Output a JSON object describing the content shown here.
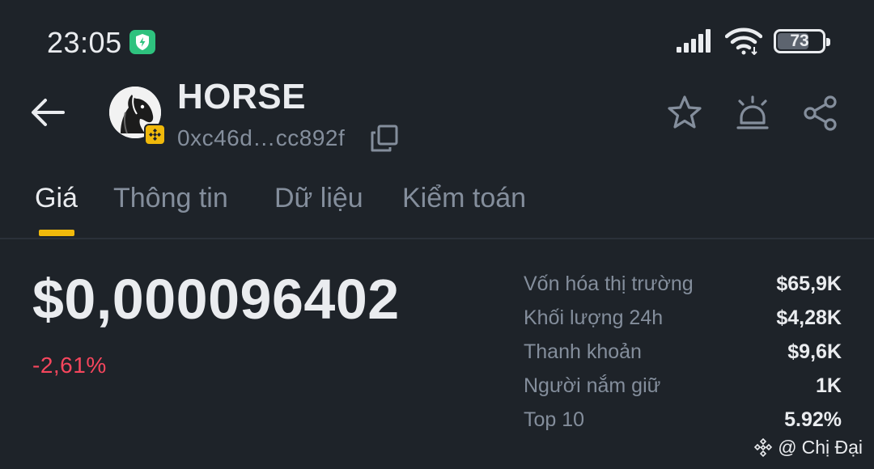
{
  "status_bar": {
    "time": "23:05",
    "battery": "73",
    "battery_level": 0.73
  },
  "header": {
    "back_icon": "back-arrow-icon",
    "token_name": "HORSE",
    "contract_address": "0xc46d…cc892f",
    "avatar_icon": "horse-head-icon",
    "chain_badge_icon": "bnb-chain-icon",
    "copy_icon": "copy-icon",
    "favorite_icon": "star-icon",
    "alert_icon": "price-alert-icon",
    "share_icon": "share-icon"
  },
  "tabs": [
    {
      "label": "Giá",
      "active": true
    },
    {
      "label": "Thông tin",
      "active": false
    },
    {
      "label": "Dữ liệu",
      "active": false
    },
    {
      "label": "Kiểm toán",
      "active": false
    }
  ],
  "price": {
    "value": "$0,000096402",
    "change": "-2,61%"
  },
  "stats": [
    {
      "label": "Vốn hóa thị trường",
      "value": "$65,9K"
    },
    {
      "label": "Khối lượng 24h",
      "value": "$4,28K"
    },
    {
      "label": "Thanh khoản",
      "value": "$9,6K"
    },
    {
      "label": "Người nắm giữ",
      "value": "1K"
    },
    {
      "label": "Top 10",
      "value": "5.92%"
    }
  ],
  "watermark": {
    "text": "Chị Đại"
  },
  "colors": {
    "background": "#1e2329",
    "accent": "#f0b90b",
    "negative": "#f6465d",
    "muted_text": "#848e9c",
    "status_green": "#2ec27e"
  }
}
